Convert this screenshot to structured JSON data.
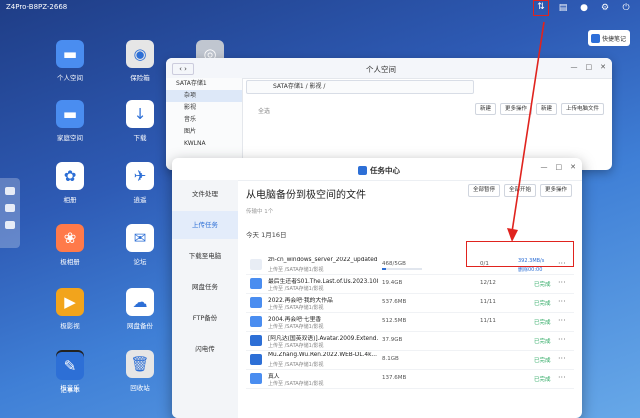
{
  "topbar": {
    "device_name": "Z4Pro-B8PZ-2668"
  },
  "quicknote": {
    "label": "快捷笔记"
  },
  "desktop_icons": [
    {
      "label": "个人空间",
      "icon": "folder-icon",
      "color": "#4a8df0"
    },
    {
      "label": "保险箱",
      "icon": "safe-icon",
      "color": "#e6e6e6"
    },
    {
      "label": "",
      "icon": "disk-icon",
      "color": "#c0c6d0"
    },
    {
      "label": "家庭空间",
      "icon": "family-folder-icon",
      "color": "#4a8df0"
    },
    {
      "label": "下载",
      "icon": "download-icon",
      "color": "#ffffff"
    },
    {
      "label": "相册",
      "icon": "photos-icon",
      "color": "#ffffff"
    },
    {
      "label": "极相册",
      "icon": "album-icon",
      "color": "#ff7a4a"
    },
    {
      "label": "逍遥",
      "icon": "flight-icon",
      "color": "#ffffff"
    },
    {
      "label": "极影视",
      "icon": "video-icon",
      "color": "#f2a41c"
    },
    {
      "label": "论坛",
      "icon": "forum-icon",
      "color": "#ffffff"
    },
    {
      "label": "极音乐",
      "icon": "music-icon",
      "color": "#222222"
    },
    {
      "label": "网盘备份",
      "icon": "cloud-backup-icon",
      "color": "#ffffff"
    },
    {
      "label": "记事本",
      "icon": "notepad-icon",
      "color": "#2d6fd6"
    },
    {
      "label": "回收站",
      "icon": "trash-icon",
      "color": "#e6e6e6"
    }
  ],
  "file_manager": {
    "title": "个人空间",
    "path": "SATA存储1 / 影视 /",
    "sidebar": [
      "SATA存储1",
      "杂项",
      "影视",
      "音乐",
      "图片",
      "KWLNA"
    ],
    "empty_label": "全选",
    "tools": [
      "新建",
      "更多操作",
      "新建",
      "上传电脑文件"
    ]
  },
  "task_center": {
    "title": "任务中心",
    "nav": [
      "文件处理",
      "上传任务",
      "下载至电脑",
      "网盘任务",
      "FTP备份",
      "闪电传"
    ],
    "active_nav": 1,
    "heading": "从电脑备份到极空间的文件",
    "sub": "传输中 1个",
    "actions": [
      "全部暂停",
      "全部开始",
      "更多操作"
    ],
    "group": "今天 1月16日",
    "rows": [
      {
        "name": "zh-cn_windows_server_2022_updated...",
        "dest": "上传至 /SATA存储1/影视",
        "size": "468/5GB",
        "count": "0/1",
        "speed": "392.3MB/s",
        "state": "删除00:00",
        "status": "",
        "icon": "#e8edf5",
        "progress": 0.09
      },
      {
        "name": "最后生还者S01.The.Last.of.Us.2023.108...",
        "dest": "上传至 /SATA存储1/影视",
        "size": "19.4GB",
        "count": "12/12",
        "speed": "",
        "state": "",
        "status": "已完成",
        "icon": "#4a8df0",
        "progress": 1
      },
      {
        "name": "2022.再会吧·我的大作品",
        "dest": "上传至 /SATA存储1/影视",
        "size": "537.6MB",
        "count": "11/11",
        "speed": "",
        "state": "",
        "status": "已完成",
        "icon": "#4a8df0",
        "progress": 1
      },
      {
        "name": "2004.再会吧·七里香",
        "dest": "上传至 /SATA存储1/影视",
        "size": "512.5MB",
        "count": "11/11",
        "speed": "",
        "state": "",
        "status": "已完成",
        "icon": "#4a8df0",
        "progress": 1
      },
      {
        "name": "[阿凡达(国英双语)].Avatar.2009.Extend...",
        "dest": "上传至 /SATA存储1/影视",
        "size": "37.9GB",
        "count": "",
        "speed": "",
        "state": "",
        "status": "已完成",
        "icon": "#2d6fd6",
        "progress": 1
      },
      {
        "name": "Mu.Zhang.Wu.Ren.2022.WEB-DL.4k...",
        "dest": "上传至 /SATA存储1/影视",
        "size": "8.1GB",
        "count": "",
        "speed": "",
        "state": "",
        "status": "已完成",
        "icon": "#2d6fd6",
        "progress": 1
      },
      {
        "name": "真人",
        "dest": "上传至 /SATA存储1/影视",
        "size": "137.6MB",
        "count": "",
        "speed": "",
        "state": "",
        "status": "已完成",
        "icon": "#4a8df0",
        "progress": 1
      }
    ]
  }
}
